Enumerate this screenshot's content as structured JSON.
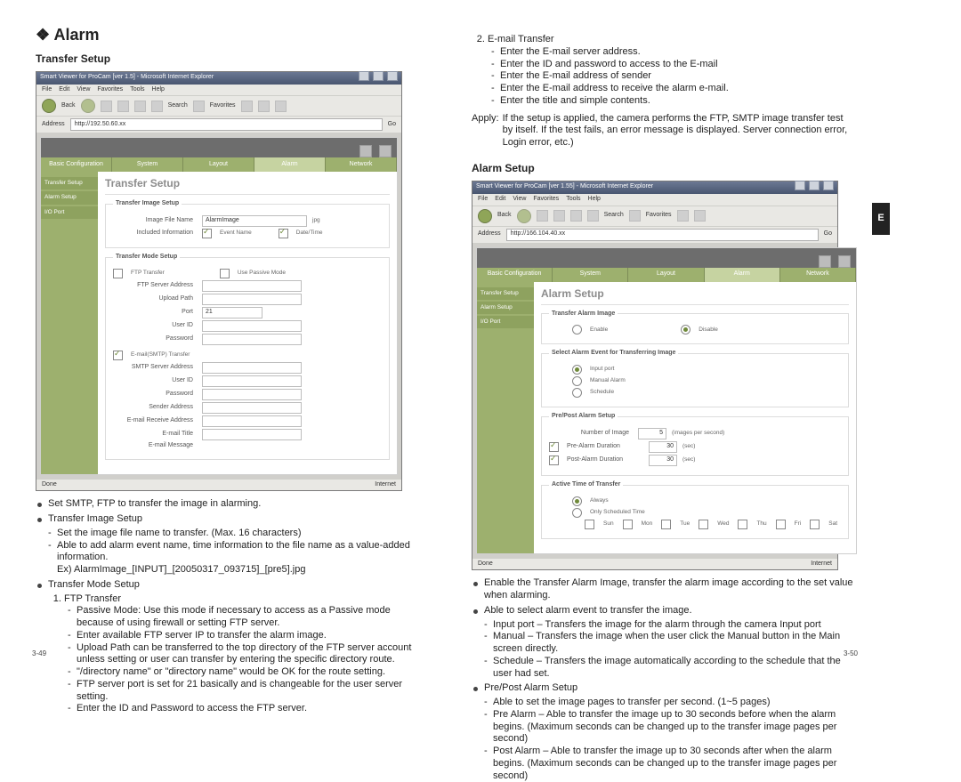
{
  "left": {
    "section_heading": "❖ Alarm",
    "subheading": "Transfer Setup",
    "page_num": "3-49",
    "bullets": [
      {
        "text": "Set SMTP, FTP to transfer the image in alarming."
      },
      {
        "text": "Transfer Image Setup",
        "sub": [
          "Set the image file name to transfer. (Max. 16 characters)",
          "Able to add alarm event name, time information to the file name as a value-added information.\nEx) AlarmImage_[INPUT]_[20050317_093715]_[pre5].jpg"
        ]
      },
      {
        "text": "Transfer Mode Setup",
        "ordered": [
          {
            "text": "FTP Transfer",
            "sub": [
              "Passive Mode: Use this mode if necessary to access as a Passive mode because of using firewall or setting FTP server.",
              "Enter available FTP server IP to transfer the alarm image.",
              "Upload Path can be transferred to the top directory of the FTP server account unless setting or user can transfer by entering the specific directory route.",
              "\"/directory name\" or \"directory name\" would be OK for the route setting.",
              "FTP server port is set for 21 basically and is changeable for the user server setting.",
              "Enter the ID and Password to access the FTP server."
            ]
          }
        ]
      }
    ],
    "ie": {
      "title": "Smart Viewer for ProCam [ver 1.5] - Microsoft Internet Explorer",
      "menu": [
        "File",
        "Edit",
        "View",
        "Favorites",
        "Tools",
        "Help"
      ],
      "tools_labels": [
        "Back",
        "",
        "",
        "",
        "Search",
        "Favorites",
        "",
        "",
        "",
        ""
      ],
      "address_label": "Address",
      "address_value": "http://192.50.60.xx",
      "go_label": "Go",
      "status_done": "Done",
      "status_net": "Internet",
      "tabs": [
        "Basic Configuration",
        "System",
        "Layout",
        "Alarm",
        "Network"
      ],
      "tabs_active_idx": 3,
      "side_items": [
        "Transfer Setup",
        "Alarm Setup",
        "I/O Port"
      ],
      "pane_title": "Transfer Setup",
      "g1": {
        "legend": "Transfer Image Setup",
        "img_file_lbl": "Image File Name",
        "img_file_val": "AlarmImage",
        "jpg": "jpg",
        "incl_lbl": "Included Information",
        "chk_eventname": "Event Name",
        "chk_datetime": "Date/Time"
      },
      "g2": {
        "legend": "Transfer Mode Setup",
        "ftp_chk": "FTP Transfer",
        "passive": "Use Passive Mode",
        "ftp_addr_lbl": "FTP Server Address",
        "upload_lbl": "Upload Path",
        "port_lbl": "Port",
        "port_val": "21",
        "userid_lbl": "User ID",
        "pw_lbl": "Password",
        "smtp_chk": "E-mail(SMTP) Transfer",
        "smtp_addr_lbl": "SMTP Server Address",
        "smtp_user_lbl": "User ID",
        "smtp_pw_lbl": "Password",
        "sender_lbl": "Sender Address",
        "recv_lbl": "E-mail Receive Address",
        "title_lbl": "E-mail Title",
        "msg_lbl": "E-mail Message"
      }
    }
  },
  "right": {
    "page_num": "3-50",
    "side_tab": "E",
    "email": {
      "heading": "E-mail Transfer",
      "items": [
        "Enter the E-mail server address.",
        "Enter the ID and password to access to the E-mail",
        "Enter the E-mail address of sender",
        "Enter the E-mail address to receive the alarm e-mail.",
        "Enter the title and simple contents."
      ]
    },
    "apply_label": "Apply:",
    "apply_text": "If the setup is applied, the camera performs the FTP, SMTP image transfer test by itself. If the test fails, an error message is displayed. Server connection error, Login error, etc.)",
    "subheading": "Alarm Setup",
    "bullets": [
      {
        "text": "Enable the Transfer Alarm Image, transfer the alarm image according to the set value when alarming."
      },
      {
        "text": "Able to select alarm event to transfer the image.",
        "sub": [
          "Input port – Transfers the image for the alarm through the camera Input port",
          "Manual – Transfers the image when the user click the Manual button in the Main screen directly.",
          "Schedule – Transfers the image automatically according to the schedule that the user had set."
        ]
      },
      {
        "text": "Pre/Post Alarm Setup",
        "sub": [
          "Able to set the image pages to transfer per second. (1~5 pages)",
          "Pre Alarm – Able to transfer the image up to 30 seconds before when the alarm begins. (Maximum seconds can be changed up to the transfer image pages per second)",
          "Post Alarm – Able to transfer the image up to 30 seconds after when the alarm begins. (Maximum seconds can be changed up to the transfer image pages per second)"
        ]
      }
    ],
    "ie2": {
      "title": "Smart Viewer for ProCam [ver 1.55] - Microsoft Internet Explorer",
      "address_value": "http://166.104.40.xx",
      "pane_title": "Alarm Setup",
      "side_items": [
        "Transfer Setup",
        "Alarm Setup",
        "I/O Port"
      ],
      "g1": {
        "legend": "Transfer Alarm Image",
        "enable": "Enable",
        "disable": "Disable"
      },
      "g2": {
        "legend": "Select Alarm Event for Transferring Image",
        "opt1": "Input port",
        "opt2": "Manual Alarm",
        "opt3": "Schedule"
      },
      "g3": {
        "legend": "Pre/Post Alarm Setup",
        "num_lbl": "Number of Image",
        "num_val": "5",
        "num_unit": "(images per second)",
        "pre_lbl": "Pre-Alarm Duration",
        "pre_val": "30",
        "pre_unit": "(sec)",
        "post_lbl": "Post-Alarm Duration",
        "post_val": "30",
        "post_unit": "(sec)"
      },
      "g4": {
        "legend": "Active Time of Transfer",
        "opt1": "Always",
        "opt2": "Only Scheduled Time",
        "days": [
          "Sun",
          "Mon",
          "Tue",
          "Wed",
          "Thu",
          "Fri",
          "Sat"
        ]
      }
    }
  }
}
